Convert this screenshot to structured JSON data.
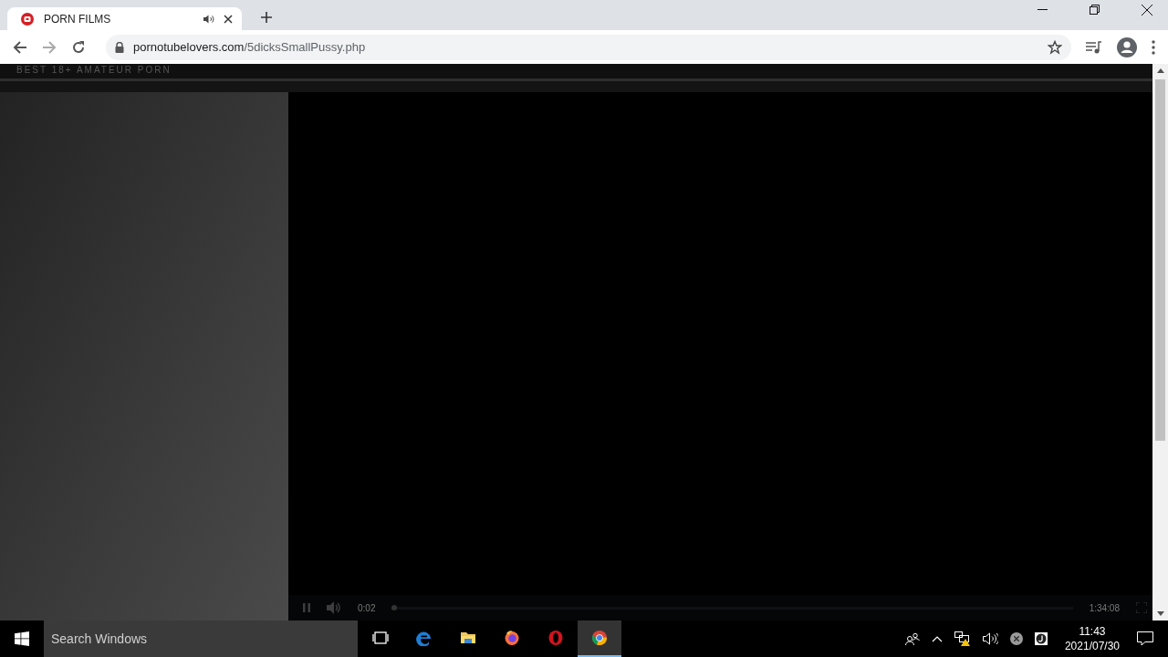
{
  "browser": {
    "tab": {
      "title": "PORN FILMS",
      "audio_playing": true,
      "selected": true
    },
    "url": {
      "host": "pornotubelovers.com",
      "path": "/5dicksSmallPussy.php"
    }
  },
  "page": {
    "tagline": "BEST 18+ AMATEUR PORN"
  },
  "player": {
    "paused": false,
    "elapsed": "0:02",
    "duration": "1:34:08",
    "level": 0.003
  },
  "taskbar": {
    "search_placeholder": "Search Windows",
    "apps": [
      {
        "kind": "task-view",
        "selected": false
      },
      {
        "kind": "edge",
        "selected": false
      },
      {
        "kind": "explorer",
        "selected": false
      },
      {
        "kind": "firefox",
        "selected": false
      },
      {
        "kind": "opera",
        "selected": false
      },
      {
        "kind": "chrome",
        "selected": true
      }
    ],
    "time": "11:43",
    "date": "2021/07/30"
  }
}
